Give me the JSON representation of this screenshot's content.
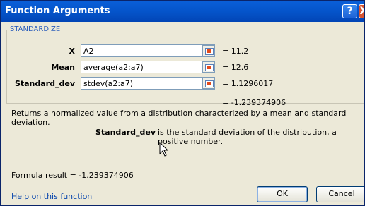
{
  "window": {
    "title": "Function Arguments",
    "help_glyph": "?",
    "close_glyph": "X"
  },
  "function_name": "STANDARDIZE",
  "arguments": [
    {
      "label": "X",
      "input": "A2",
      "value": "= 11.2"
    },
    {
      "label": "Mean",
      "input": "average(a2:a7)",
      "value": "= 12.6"
    },
    {
      "label": "Standard_dev",
      "input": "stdev(a2:a7)",
      "value": "= 1.1296017"
    }
  ],
  "result_preview": "= -1.239374906",
  "description": "Returns a normalized value from a distribution characterized by a mean and standard deviation.",
  "parameter_help": {
    "name": "Standard_dev",
    "text": "is the standard deviation of the distribution, a positive number."
  },
  "formula_result": "Formula result =  -1.239374906",
  "help_link": "Help on this function",
  "buttons": {
    "ok": "OK",
    "cancel": "Cancel"
  },
  "colors": {
    "titlebar": "#0453c9",
    "dialog_bg": "#ece9d8",
    "group_label": "#2c5ebb",
    "link": "#0645ad"
  },
  "icons": {
    "ref_button": "collapse-dialog-icon",
    "cursor": "mouse-pointer-icon"
  }
}
